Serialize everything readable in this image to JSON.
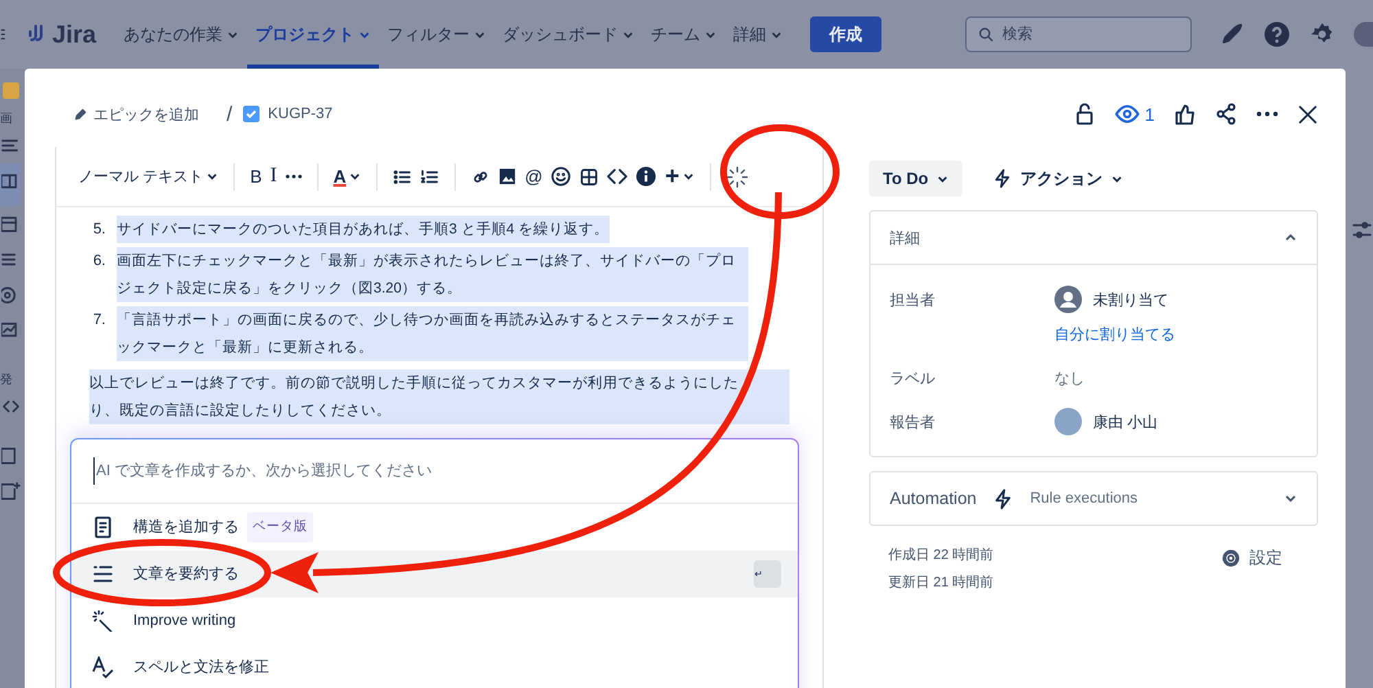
{
  "top_nav": {
    "logo": "Jira",
    "items": [
      {
        "label": "あなたの作業",
        "selected": false
      },
      {
        "label": "プロジェクト",
        "selected": true
      },
      {
        "label": "フィルター",
        "selected": false
      },
      {
        "label": "ダッシュボード",
        "selected": false
      },
      {
        "label": "チーム",
        "selected": false
      },
      {
        "label": "詳細",
        "selected": false
      }
    ],
    "create_button": "作成",
    "search": {
      "placeholder": "検索"
    }
  },
  "sidebar": {
    "fragments": [
      "画",
      "発"
    ]
  },
  "issue": {
    "epic_link": "エピックを追加",
    "separator": "/",
    "key": "KUGP-37",
    "watchers": "1"
  },
  "editor": {
    "text_style": "ノーマル テキスト",
    "toolbar": {
      "bold": "B",
      "italic": "I",
      "text_color": "A",
      "mention": "@",
      "insert": "+"
    },
    "text_selected": true,
    "list": [
      {
        "number": "5.",
        "text": "サイドバーにマークのついた項目があれば、手順3 と手順4 を繰り返す。"
      },
      {
        "number": "6.",
        "text": "画面左下にチェックマークと「最新」が表示されたらレビューは終了、サイドバーの「プロジェクト設定に戻る」をクリック（図3.20）する。"
      },
      {
        "number": "7.",
        "text": "「言語サポート」の画面に戻るので、少し待つか画面を再読み込みするとステータスがチェックマークと「最新」に更新される。"
      }
    ],
    "paragraph": "以上でレビューは終了です。前の節で説明した手順に従ってカスタマーが利用できるようにしたり、既定の言語に設定したりしてください。",
    "ai_panel": {
      "placeholder": "AI で文章を作成するか、次から選択してください",
      "options": [
        {
          "kind": "structure",
          "label": "構造を追加する",
          "badge": "ベータ版",
          "selected": false
        },
        {
          "kind": "summarize",
          "label": "文章を要約する",
          "selected": true
        },
        {
          "kind": "improve",
          "label": "Improve writing",
          "selected": false
        },
        {
          "kind": "spelling",
          "label": "スペルと文法を修正",
          "selected": false
        }
      ]
    }
  },
  "status": {
    "label": "To Do"
  },
  "actions": {
    "label": "アクション"
  },
  "details": {
    "title": "詳細",
    "expanded": true,
    "fields": [
      {
        "kind": "assignee",
        "label": "担当者",
        "value": "未割り当て",
        "link": "自分に割り当てる"
      },
      {
        "kind": "text",
        "label": "ラベル",
        "value": "なし"
      },
      {
        "kind": "user",
        "label": "報告者",
        "value": "康由 小山"
      }
    ]
  },
  "automation": {
    "title": "Automation",
    "subtitle": "Rule executions",
    "expanded": false
  },
  "dates": [
    "作成日 22 時間前",
    "更新日 21 時間前"
  ],
  "settings": "設定"
}
